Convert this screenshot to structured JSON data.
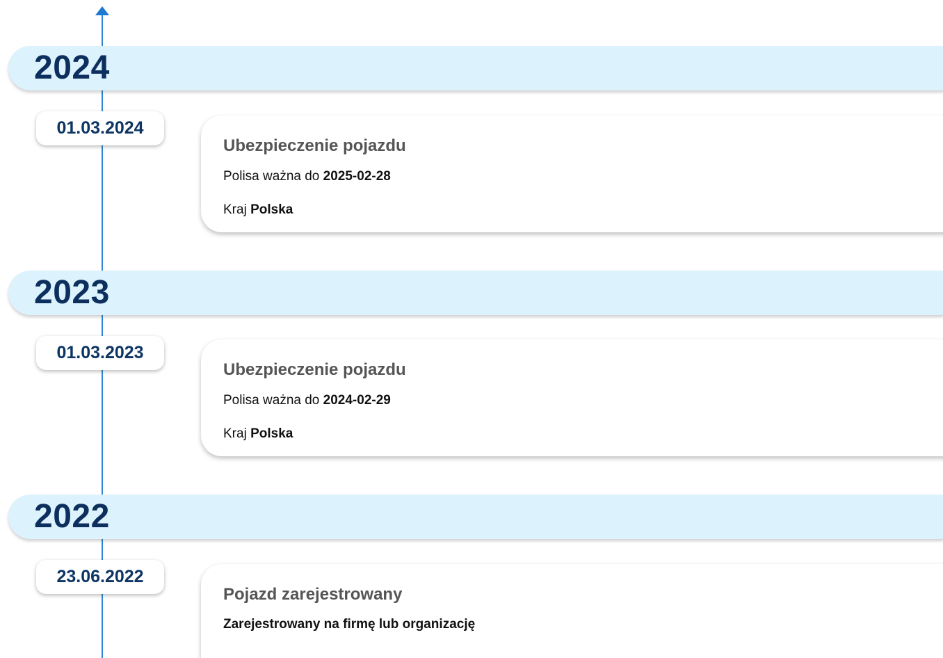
{
  "timeline": {
    "years": [
      {
        "year": "2024",
        "entries": [
          {
            "date": "01.03.2024",
            "title": "Ubezpieczenie pojazdu",
            "policy_label": "Polisa ważna do",
            "policy_value": "2025-02-28",
            "country_label": "Kraj",
            "country_value": "Polska"
          }
        ]
      },
      {
        "year": "2023",
        "entries": [
          {
            "date": "01.03.2023",
            "title": "Ubezpieczenie pojazdu",
            "policy_label": "Polisa ważna do",
            "policy_value": "2024-02-29",
            "country_label": "Kraj",
            "country_value": "Polska"
          }
        ]
      },
      {
        "year": "2022",
        "entries": [
          {
            "date": "23.06.2022",
            "title": "Pojazd zarejestrowany",
            "description": "Zarejestrowany na firmę lub organizację"
          }
        ]
      }
    ]
  },
  "colors": {
    "axis": "#2f86d6",
    "year_band": "#dcf2fd",
    "year_text": "#0d2f5e",
    "date_text": "#0d3564",
    "card_title": "#555555"
  },
  "icons": {
    "axis_arrow": "arrow-up-icon"
  }
}
